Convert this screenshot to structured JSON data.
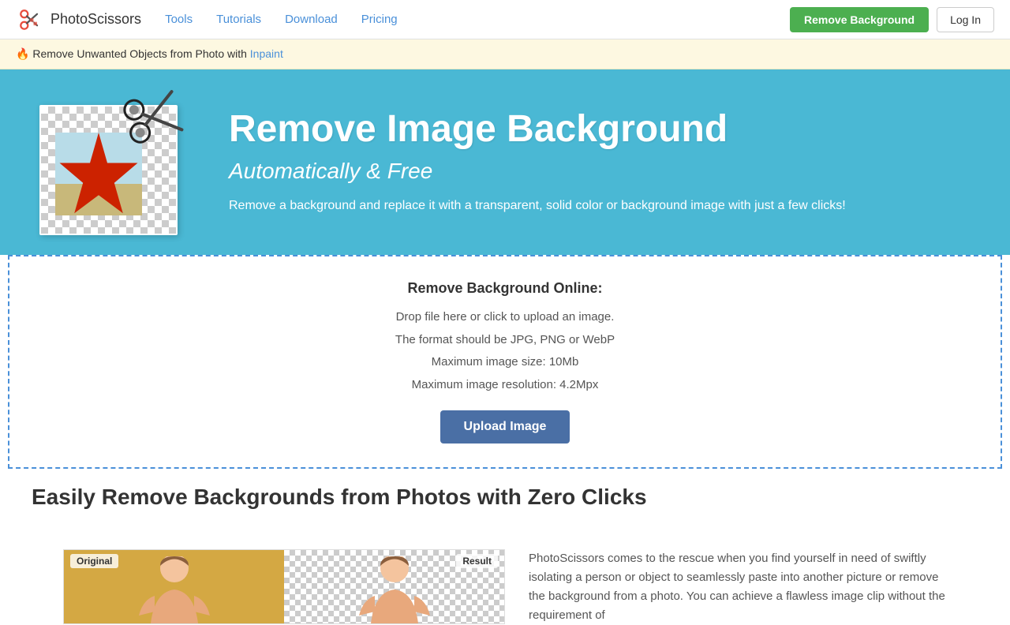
{
  "brand": {
    "name": "PhotoScissors",
    "logo_alt": "PhotoScissors logo"
  },
  "navbar": {
    "links": [
      {
        "id": "tools",
        "label": "Tools"
      },
      {
        "id": "tutorials",
        "label": "Tutorials"
      },
      {
        "id": "download",
        "label": "Download"
      },
      {
        "id": "pricing",
        "label": "Pricing"
      }
    ],
    "remove_bg_btn": "Remove Background",
    "login_btn": "Log In"
  },
  "banner": {
    "fire_emoji": "🔥",
    "text": "Remove Unwanted Objects from Photo with ",
    "link_text": "Inpaint"
  },
  "hero": {
    "title": "Remove Image Background",
    "subtitle": "Automatically & Free",
    "description": "Remove a background and replace it with a transparent, solid color or background image with just a few clicks!"
  },
  "upload_section": {
    "title": "Remove Background Online:",
    "line1": "Drop file here or click to upload an image.",
    "line2": "The format should be JPG, PNG or WebP",
    "line3": "Maximum image size: 10Mb",
    "line4": "Maximum image resolution: 4.2Mpx",
    "button": "Upload Image"
  },
  "section_bottom": {
    "title": "Easily Remove Backgrounds from Photos with Zero Clicks",
    "demo_original_label": "Original",
    "demo_result_label": "Result",
    "description": "PhotoScissors comes to the rescue when you find yourself in need of swiftly isolating a person or object to seamlessly paste into another picture or remove the background from a photo. You can achieve a flawless image clip without the requirement of"
  }
}
